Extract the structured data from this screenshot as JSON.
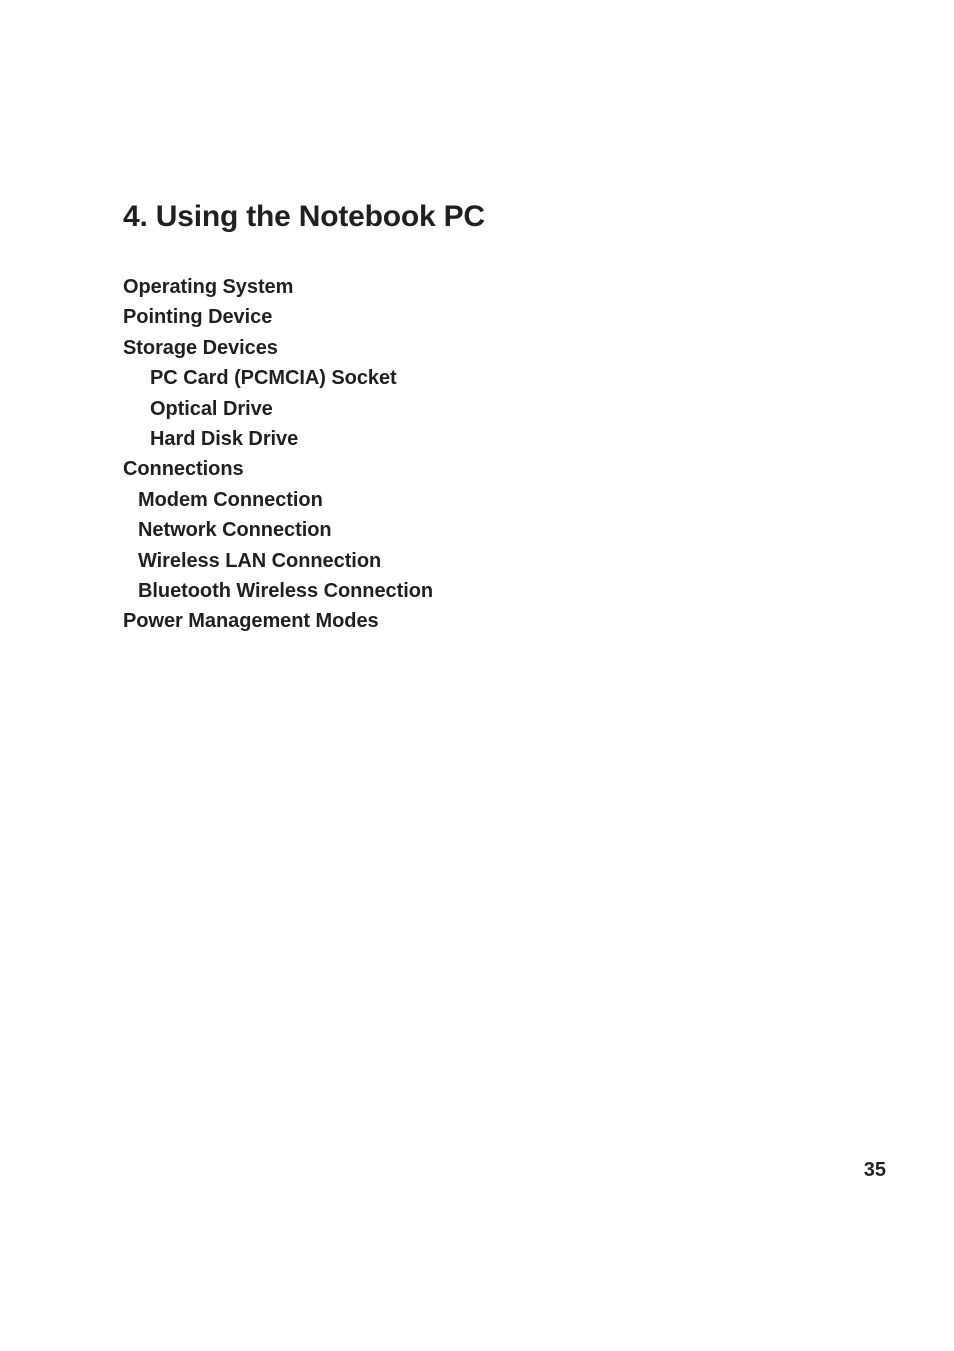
{
  "document": {
    "chapter_title": "4. Using the Notebook PC",
    "page_number": "35",
    "text_color": "#231f20",
    "background_color": "#ffffff",
    "contents": [
      {
        "label": "Operating System",
        "level": 0
      },
      {
        "label": "Pointing Device",
        "level": 0
      },
      {
        "label": "Storage Devices",
        "level": 0
      },
      {
        "label": "PC Card (PCMCIA) Socket",
        "level": 2
      },
      {
        "label": "Optical Drive",
        "level": 2
      },
      {
        "label": "Hard Disk Drive",
        "level": 2
      },
      {
        "label": "Connections",
        "level": 0
      },
      {
        "label": "Modem Connection",
        "level": 1
      },
      {
        "label": "Network Connection",
        "level": 1
      },
      {
        "label": "Wireless LAN Connection",
        "level": 1
      },
      {
        "label": "Bluetooth Wireless Connection",
        "level": 1
      },
      {
        "label": "Power Management Modes",
        "level": 0
      }
    ]
  }
}
